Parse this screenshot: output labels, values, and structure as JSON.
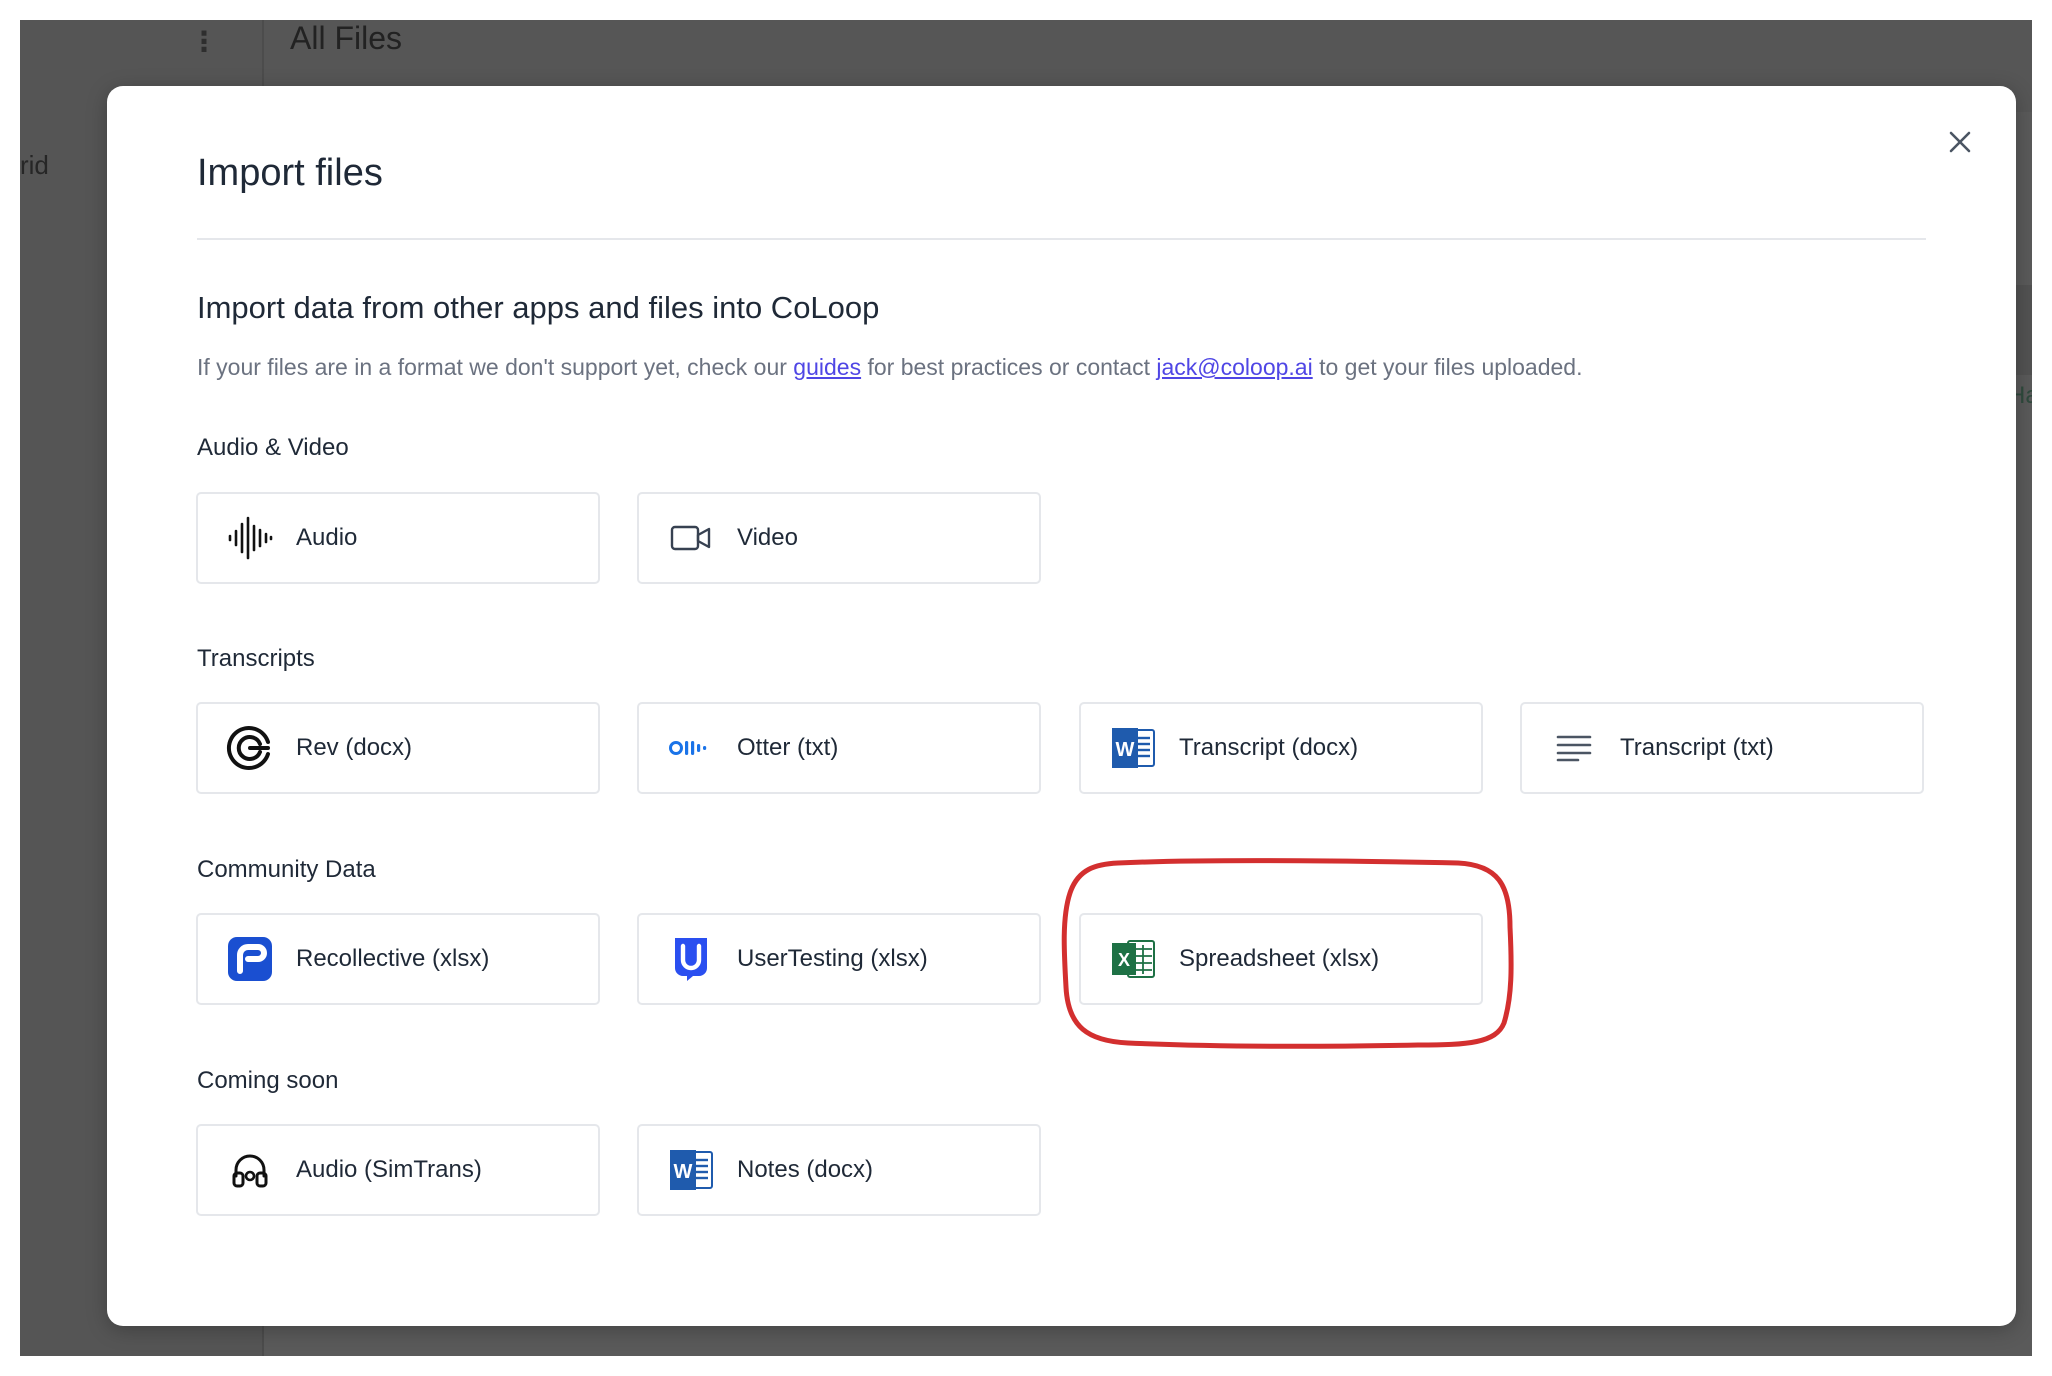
{
  "background": {
    "page_title": "All Files",
    "grid_label": "rid",
    "right_text": "Ha"
  },
  "modal": {
    "title": "Import files",
    "close_label": "×",
    "heading": "Import data from other apps and files into CoLoop",
    "description": {
      "part1": "If your files are in a format we don't support yet, check our ",
      "link1": "guides",
      "part2": " for best practices or contact ",
      "link2": "jack@coloop.ai",
      "part3": " to get your files uploaded."
    },
    "groups": {
      "audio_video": {
        "label": "Audio & Video",
        "items": [
          {
            "label": "Audio",
            "icon": "audio-waveform-icon"
          },
          {
            "label": "Video",
            "icon": "video-camera-icon"
          }
        ]
      },
      "transcripts": {
        "label": "Transcripts",
        "items": [
          {
            "label": "Rev (docx)",
            "icon": "rev-logo-icon"
          },
          {
            "label": "Otter (txt)",
            "icon": "otter-logo-icon"
          },
          {
            "label": "Transcript (docx)",
            "icon": "word-icon"
          },
          {
            "label": "Transcript (txt)",
            "icon": "text-lines-icon"
          }
        ]
      },
      "community": {
        "label": "Community Data",
        "items": [
          {
            "label": "Recollective (xlsx)",
            "icon": "recollective-logo-icon"
          },
          {
            "label": "UserTesting (xlsx)",
            "icon": "usertesting-logo-icon"
          },
          {
            "label": "Spreadsheet (xlsx)",
            "icon": "excel-icon"
          }
        ]
      },
      "coming_soon": {
        "label": "Coming soon",
        "items": [
          {
            "label": "Audio (SimTrans)",
            "icon": "headphones-icon"
          },
          {
            "label": "Notes (docx)",
            "icon": "word-icon"
          }
        ]
      }
    }
  },
  "colors": {
    "overlay": "#5a5a5a",
    "link": "#4f46e5",
    "highlight": "#d32f2f",
    "word_blue": "#1f5bad",
    "excel_green": "#1e7145",
    "otter_blue": "#1a73e8",
    "recollective_blue": "#1a4fd1",
    "usertesting_blue": "#2a4ff0"
  }
}
